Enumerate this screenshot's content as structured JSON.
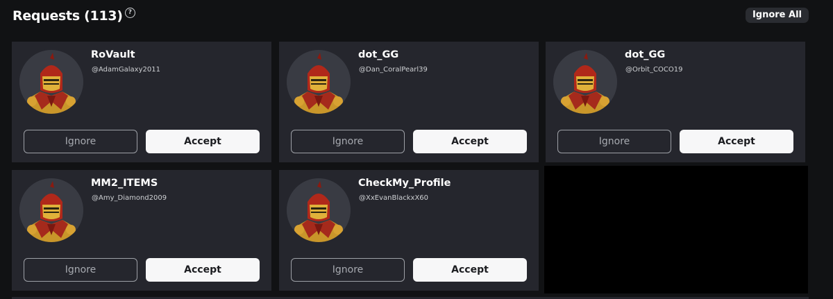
{
  "header": {
    "title": "Requests (113)",
    "help_icon": "question-circle-icon",
    "ignore_all_label": "Ignore All"
  },
  "colors": {
    "background": "#111214",
    "card": "#25262d",
    "accept_button": "#f7f7f8",
    "ignore_border": "#9ea1a7"
  },
  "requests": [
    {
      "name": "RoVault",
      "handle": "@AdamGalaxy2011",
      "ignore_label": "Ignore",
      "accept_label": "Accept",
      "avatar_icon": "knight-avatar-icon"
    },
    {
      "name": "dot_GG",
      "handle": "@Dan_CoralPearl39",
      "ignore_label": "Ignore",
      "accept_label": "Accept",
      "avatar_icon": "knight-avatar-icon"
    },
    {
      "name": "dot_GG",
      "handle": "@Orbit_COCO19",
      "ignore_label": "Ignore",
      "accept_label": "Accept",
      "avatar_icon": "knight-avatar-icon"
    },
    {
      "name": "MM2_ITEMS",
      "handle": "@Amy_Diamond2009",
      "ignore_label": "Ignore",
      "accept_label": "Accept",
      "avatar_icon": "knight-avatar-icon"
    },
    {
      "name": "CheckMy_Profile",
      "handle": "@XxEvanBlackxX60",
      "ignore_label": "Ignore",
      "accept_label": "Accept",
      "avatar_icon": "knight-avatar-icon"
    }
  ]
}
